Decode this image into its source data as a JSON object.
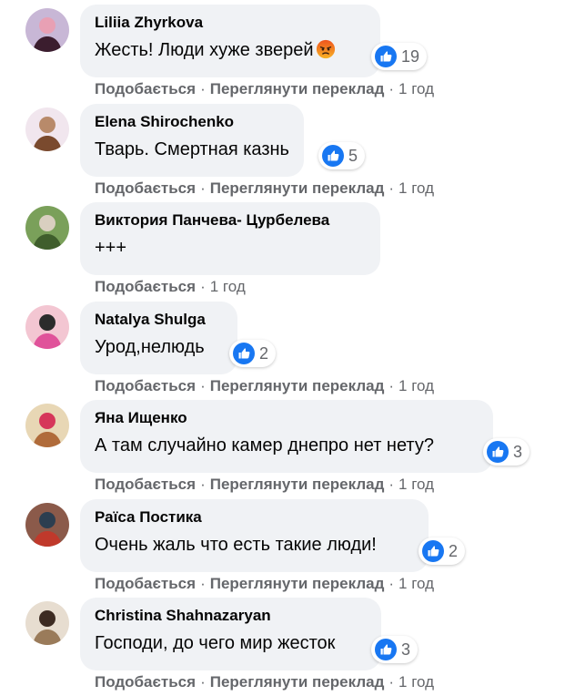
{
  "actions": {
    "like": "Подобається",
    "translate": "Переглянути переклад",
    "separator": "·"
  },
  "comments": [
    {
      "author": "Liliia Zhyrkova",
      "text": "Жесть! Люди хуже зверей",
      "emoji": "angry-face-icon",
      "reactions": "19",
      "time": "1 год",
      "has_translate": true,
      "avatar_colors": [
        "#c8b7d6",
        "#3b1d2e",
        "#e8a0b4"
      ]
    },
    {
      "author": "Elena Shirochenko",
      "text": "Тварь. Смертная казнь",
      "reactions": "5",
      "time": "1 год",
      "has_translate": true,
      "avatar_colors": [
        "#f1e6ee",
        "#7a4a2e",
        "#b88a6a"
      ]
    },
    {
      "author": "Виктория Панчева- Цурбелева",
      "text": "+++",
      "reactions": "",
      "time": "1 год",
      "has_translate": false,
      "avatar_colors": [
        "#7aa05a",
        "#3f5e2c",
        "#d9cfc0"
      ]
    },
    {
      "author": "Natalya Shulga",
      "text": "Урод,нелюдь",
      "reactions": "2",
      "time": "1 год",
      "has_translate": true,
      "avatar_colors": [
        "#f3c6d2",
        "#e0529a",
        "#2b2b2b"
      ]
    },
    {
      "author": "Яна Ищенко",
      "text": "А там случайно камер днепро нет нету?",
      "reactions": "3",
      "time": "1 год",
      "has_translate": true,
      "avatar_colors": [
        "#e8d7b5",
        "#b06b3a",
        "#d6365a"
      ]
    },
    {
      "author": "Раїса Постика",
      "text": "Очень жаль что есть такие люди!",
      "reactions": "2",
      "time": "1 год",
      "has_translate": true,
      "avatar_colors": [
        "#8b5a4a",
        "#c0392b",
        "#2c3e50"
      ]
    },
    {
      "author": "Christina Shahnazaryan",
      "text": "Господи, до чего мир жесток",
      "reactions": "3",
      "time": "1 год",
      "has_translate": true,
      "avatar_colors": [
        "#e7ddd0",
        "#9a7b5a",
        "#3d2b22"
      ]
    }
  ],
  "colors": {
    "bubble": "#f0f2f5",
    "meta_text": "#65676b",
    "like_blue": "#1877f2"
  }
}
